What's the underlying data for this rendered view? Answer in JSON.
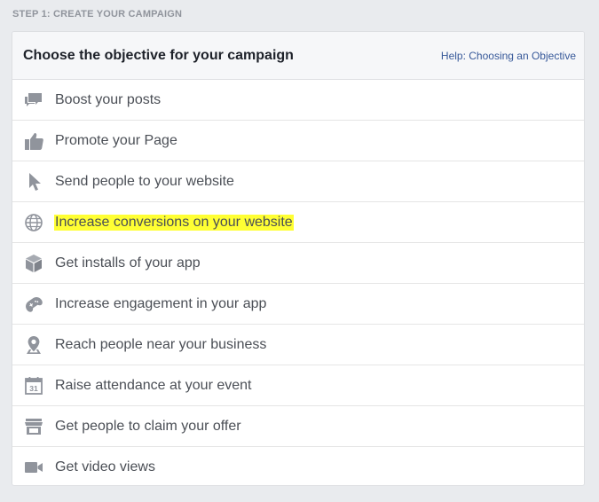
{
  "step_label": "STEP 1: CREATE YOUR CAMPAIGN",
  "card": {
    "title": "Choose the objective for your campaign",
    "help_link": "Help: Choosing an Objective"
  },
  "objectives": [
    {
      "label": "Boost your posts",
      "icon": "speech-bubbles-icon"
    },
    {
      "label": "Promote your Page",
      "icon": "thumbs-up-icon"
    },
    {
      "label": "Send people to your website",
      "icon": "cursor-pointer-icon"
    },
    {
      "label": "Increase conversions on your website",
      "icon": "globe-icon",
      "highlight_color": "#ffff33"
    },
    {
      "label": "Get installs of your app",
      "icon": "box-cube-icon"
    },
    {
      "label": "Increase engagement in your app",
      "icon": "gamepad-icon"
    },
    {
      "label": "Reach people near your business",
      "icon": "location-pin-icon"
    },
    {
      "label": "Raise attendance at your event",
      "icon": "calendar-icon",
      "icon_text": "31"
    },
    {
      "label": "Get people to claim your offer",
      "icon": "storefront-icon"
    },
    {
      "label": "Get video views",
      "icon": "video-camera-icon"
    }
  ],
  "colors": {
    "background": "#e9ebee",
    "icon": "#90949c",
    "link": "#365899",
    "highlight": "#ffff33"
  }
}
